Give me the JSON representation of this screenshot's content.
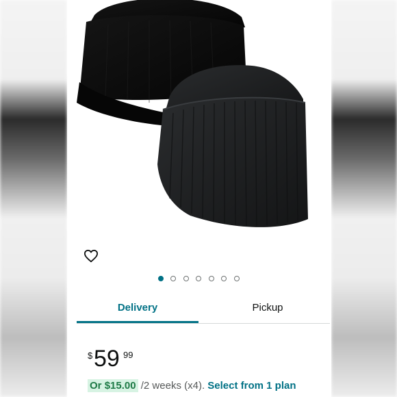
{
  "product": {
    "image_alt": "Two black cuffed knit beanie hats",
    "wishlist_icon": "heart-outline-icon"
  },
  "carousel": {
    "count": 7,
    "active_index": 0
  },
  "tabs": [
    {
      "label": "Delivery",
      "selected": true
    },
    {
      "label": "Pickup",
      "selected": false
    }
  ],
  "price": {
    "symbol": "$",
    "whole": "59",
    "fraction": "99"
  },
  "installment": {
    "prefix": "Or",
    "amount": "$15.00",
    "terms": "/2 weeks (x4).",
    "link": "Select from 1 plan"
  },
  "colors": {
    "accent": "#007185",
    "installment_bg": "#d7f3e3",
    "installment_text": "#1e7a46"
  }
}
